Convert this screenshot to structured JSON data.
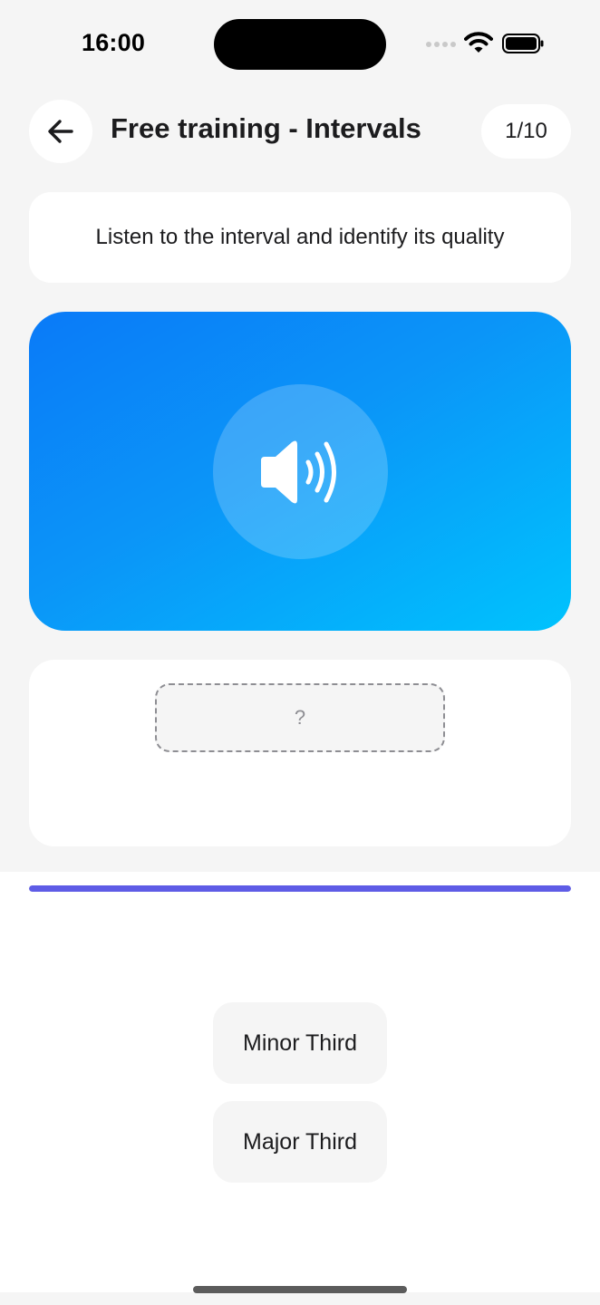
{
  "status_bar": {
    "time": "16:00",
    "icons": [
      "cellular-signal-icon",
      "wifi-icon",
      "battery-icon"
    ]
  },
  "header": {
    "back_icon": "arrow-left-icon",
    "title": "Free training - Intervals",
    "counter": "1/10"
  },
  "instruction": "Listen to the interval and identify its quality",
  "player": {
    "icon": "speaker-wave-icon",
    "gradient_start": "#0a7af8",
    "gradient_end": "#00c3fd"
  },
  "answer": {
    "placeholder": "?"
  },
  "progress": {
    "fraction": 1.0,
    "color": "#5e5ce6"
  },
  "options": [
    {
      "label": "Minor Third"
    },
    {
      "label": "Major Third"
    }
  ]
}
